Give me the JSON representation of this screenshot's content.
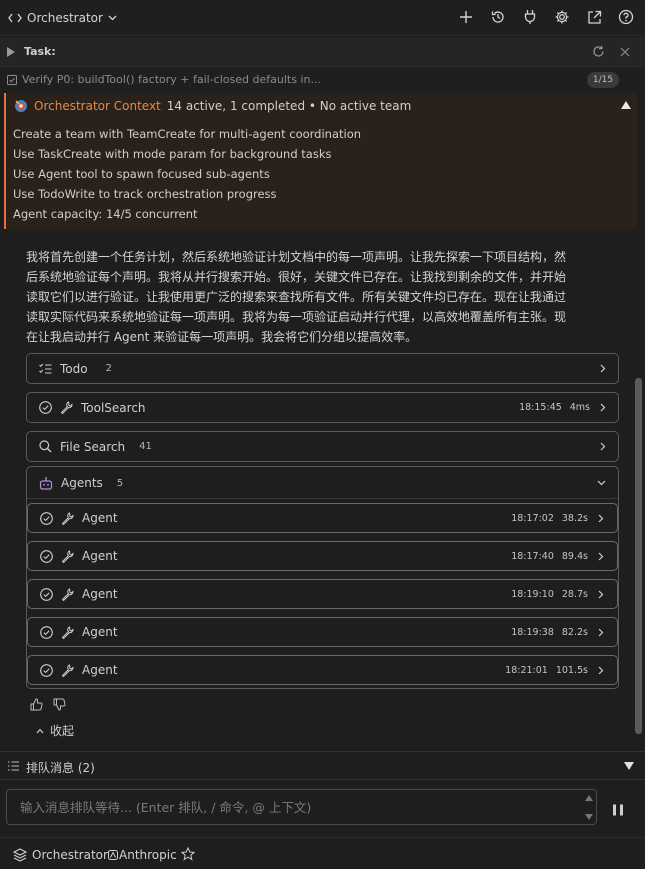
{
  "header": {
    "title": "Orchestrator",
    "icons": [
      "code-icon",
      "chevron-down-icon",
      "plus-icon",
      "history-icon",
      "plug-icon",
      "gear-icon",
      "external-link-icon",
      "help-icon"
    ]
  },
  "task": {
    "label": "Task:",
    "verify_text": "Verify P0: buildTool() factory + fail-closed defaults in...",
    "progress": "1/15"
  },
  "context": {
    "name": "Orchestrator Context",
    "status": "14 active, 1 completed • No active team",
    "lines": [
      "Create a team with TeamCreate for multi-agent coordination",
      "Use TaskCreate with mode param for background tasks",
      "Use Agent tool to spawn focused sub-agents",
      "Use TodoWrite to track orchestration progress",
      "Agent capacity: 14/5 concurrent"
    ]
  },
  "message": {
    "lines": [
      "我将首先创建一个任务计划，然后系统地验证计划文档中的每一项声明。让我先探索一下项目结构，然",
      "后系统地验证每个声明。我将从并行搜索开始。很好，关键文件已存在。让我找到剩余的文件，并开始",
      "读取它们以进行验证。让我使用更广泛的搜索来查找所有文件。所有关键文件均已存在。现在让我通过",
      "读取实际代码来系统地验证每一项声明。我将为每一项验证启动并行代理，以高效地覆盖所有主张。现",
      "在让我启动并行 Agent 来验证每一项声明。我会将它们分组以提高效率。"
    ]
  },
  "tools": {
    "todo": {
      "label": "Todo",
      "count": "2"
    },
    "toolsearch": {
      "label": "ToolSearch",
      "time": "18:15:45",
      "duration": "4ms"
    },
    "filesearch": {
      "label": "File Search",
      "count": "41"
    },
    "agents": {
      "label": "Agents",
      "count": "5"
    }
  },
  "agents": [
    {
      "label": "Agent",
      "time": "18:17:02",
      "duration": "38.2s"
    },
    {
      "label": "Agent",
      "time": "18:17:40",
      "duration": "89.4s"
    },
    {
      "label": "Agent",
      "time": "18:19:10",
      "duration": "28.7s"
    },
    {
      "label": "Agent",
      "time": "18:19:38",
      "duration": "82.2s"
    },
    {
      "label": "Agent",
      "time": "18:21:01",
      "duration": "101.5s"
    }
  ],
  "collapse_label": "收起",
  "queue": {
    "label": "排队消息 (2)"
  },
  "input": {
    "placeholder": "输入消息排队等待... (Enter 排队, / 命令, @ 上下文)"
  },
  "footer": {
    "mode": "Orchestrator",
    "provider": "Anthropic"
  },
  "colors": {
    "accent": "#e58a45",
    "background": "#1e1e1e",
    "border": "#5a5a5a"
  }
}
